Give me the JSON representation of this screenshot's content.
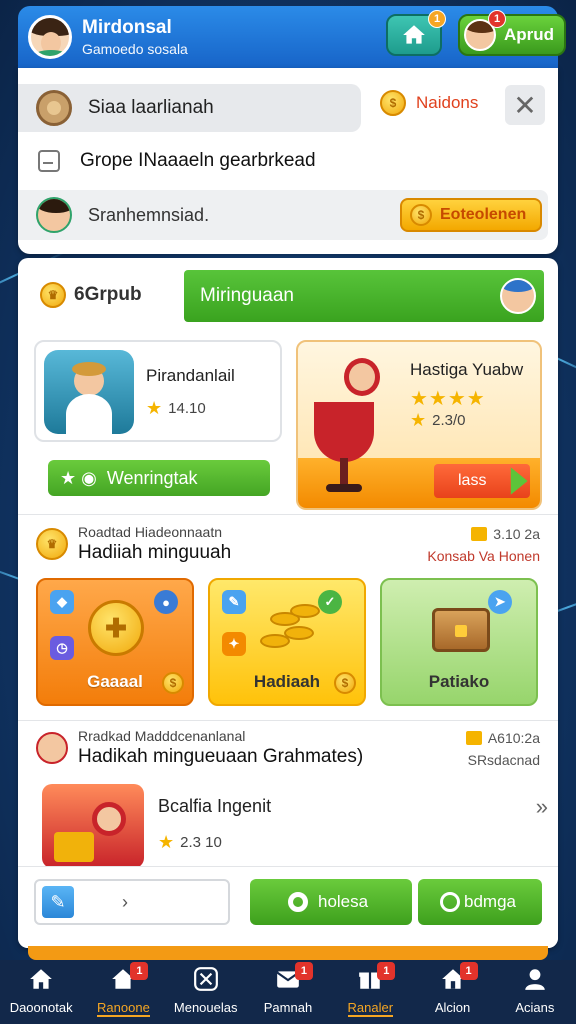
{
  "header": {
    "title": "Mirdonsal",
    "subtitle": "Gamoedo sosala",
    "home_badge": "1",
    "profile_badge": "1",
    "profile_label": "Aprud"
  },
  "top_panel": {
    "search_text": "Siaa laarlianah",
    "notif_label": "Naidons",
    "group_text": "Grope INaaaeln gearbrkead",
    "user_text": "Sranhemnsiad.",
    "user_button": "Eoteolenen"
  },
  "main": {
    "group_label": "6Grpub",
    "green_bar_text": "Miringuaan",
    "card1": {
      "title": "Pirandanlail",
      "rating": "14.10"
    },
    "card2": {
      "title": "Hastiga Yuabw",
      "stars": "★★★★",
      "rating": "2.3/0",
      "button": "lass"
    },
    "green_button": "Wenringtak",
    "section1": {
      "small": "Roadtad Hiadeonnaatn",
      "big": "Hadiiah minguuah",
      "right_top": "3.10 2a",
      "right_bottom": "Konsab Va Honen"
    },
    "tiles": [
      {
        "label": "Gaaaal",
        "color": "#f37d0a"
      },
      {
        "label": "Hadiaah",
        "color": "#ffc20a"
      },
      {
        "label": "Patiako",
        "color": "#97d56c"
      }
    ],
    "section2": {
      "small": "Rradkad Madddcenanlanal",
      "big": "Hadikah mingueuaan Grahmates)",
      "right_top": "A610:2a",
      "right_bottom": "SRsdacnad"
    },
    "list_item": {
      "title": "Bcalfia Ingenit",
      "rating": "2.3 10"
    },
    "input_value": "›",
    "btn1": "holesa",
    "btn2": "bdmga"
  },
  "bottom_nav": [
    {
      "label": "Daoonotak",
      "badge": ""
    },
    {
      "label": "Ranoone",
      "badge": "1"
    },
    {
      "label": "Menouelas",
      "badge": ""
    },
    {
      "label": "Pamnah",
      "badge": "1"
    },
    {
      "label": "Ranaler",
      "badge": "1"
    },
    {
      "label": "Alcion",
      "badge": "1"
    },
    {
      "label": "Acians",
      "badge": ""
    }
  ],
  "colors": {
    "header_blue": "#1764c8",
    "accent_green": "#44a524",
    "accent_orange": "#f3a800",
    "nav_active": "#f5a623"
  }
}
